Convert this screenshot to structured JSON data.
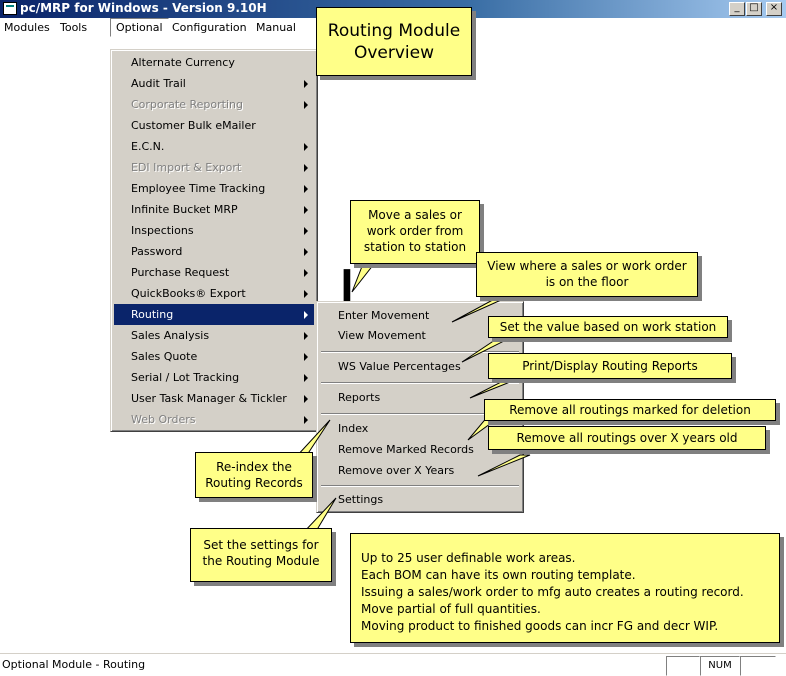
{
  "window": {
    "title": "pc/MRP for Windows - Version 9.10H",
    "controls": [
      "_",
      "□",
      "×"
    ]
  },
  "menubar": {
    "items": [
      "Modules",
      "Tools",
      "Optional",
      "Configuration",
      "Manual"
    ]
  },
  "optional_menu": {
    "items": [
      {
        "label": "Alternate Currency",
        "submenu": false,
        "disabled": false
      },
      {
        "label": "Audit Trail",
        "submenu": true,
        "disabled": false
      },
      {
        "label": "Corporate Reporting",
        "submenu": true,
        "disabled": true
      },
      {
        "label": "Customer Bulk eMailer",
        "submenu": false,
        "disabled": false
      },
      {
        "label": "E.C.N.",
        "submenu": true,
        "disabled": false
      },
      {
        "label": "EDI Import & Export",
        "submenu": true,
        "disabled": true
      },
      {
        "label": "Employee Time Tracking",
        "submenu": true,
        "disabled": false
      },
      {
        "label": "Infinite Bucket MRP",
        "submenu": true,
        "disabled": false
      },
      {
        "label": "Inspections",
        "submenu": true,
        "disabled": false
      },
      {
        "label": "Password",
        "submenu": true,
        "disabled": false
      },
      {
        "label": "Purchase Request",
        "submenu": true,
        "disabled": false
      },
      {
        "label": "QuickBooks® Export",
        "submenu": true,
        "disabled": false
      },
      {
        "label": "Routing",
        "submenu": true,
        "disabled": false,
        "selected": true
      },
      {
        "label": "Sales Analysis",
        "submenu": true,
        "disabled": false
      },
      {
        "label": "Sales Quote",
        "submenu": true,
        "disabled": false
      },
      {
        "label": "Serial / Lot Tracking",
        "submenu": true,
        "disabled": false
      },
      {
        "label": "User Task Manager & Tickler",
        "submenu": true,
        "disabled": false
      },
      {
        "label": "Web Orders",
        "submenu": true,
        "disabled": true
      }
    ]
  },
  "routing_submenu": {
    "items": [
      "Enter  Movement",
      "View  Movement",
      "WS Value Percentages",
      "Reports",
      "Index",
      "Remove Marked Records",
      "Remove over X Years",
      "Settings"
    ]
  },
  "callouts": {
    "title": "Routing Module Overview",
    "enter_movement": "Move a sales or work order from station to station",
    "view_movement": "View where a sales or work order is on the floor",
    "ws_value": "Set the value based on work station",
    "reports": "Print/Display Routing Reports",
    "remove_marked": "Remove all routings marked for deletion",
    "remove_years": "Remove all routings over X years old",
    "reindex": "Re-index the Routing Records",
    "settings": "Set the settings for the Routing Module",
    "features": [
      "Up to 25 user definable work areas.",
      "Each BOM can have its own routing template.",
      "Issuing a sales/work order to mfg auto creates a routing record.",
      "Move partial of full quantities.",
      "Moving product to finished goods can incr FG and decr WIP."
    ]
  },
  "statusbar": {
    "text": "Optional Module - Routing",
    "num": "NUM"
  },
  "colors": {
    "callout_bg": "#ffff88",
    "selection": "#0a246a",
    "menu_bg": "#d4d0c8"
  }
}
